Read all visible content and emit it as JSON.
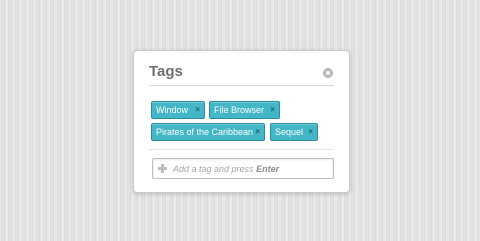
{
  "panel": {
    "title": "Tags",
    "close_icon": "close-circle-icon"
  },
  "tags": [
    {
      "label": "Window",
      "remove": "×"
    },
    {
      "label": "File Browser",
      "remove": "×"
    },
    {
      "label": "Pirates of the Caribbean",
      "remove": "×"
    },
    {
      "label": "Sequel",
      "remove": "×"
    }
  ],
  "input": {
    "icon": "plus-icon",
    "placeholder_prefix": "Add a tag and press",
    "placeholder_key": "Enter"
  },
  "colors": {
    "tag_bg": "#43b6c8",
    "tag_border": "#2c8fa0",
    "title": "#6f6f6f"
  }
}
